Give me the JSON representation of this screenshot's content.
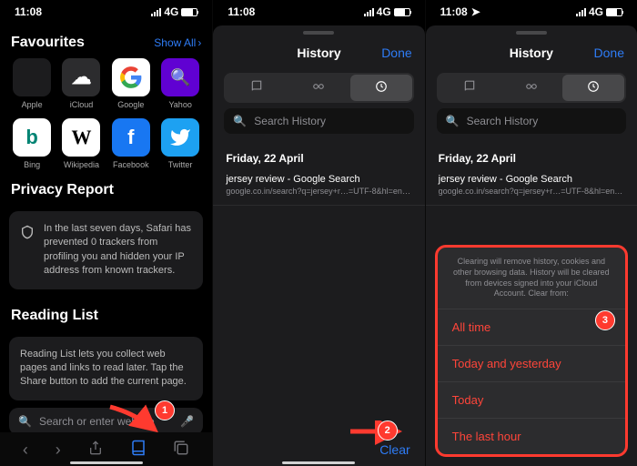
{
  "status": {
    "time": "11:08",
    "network": "4G"
  },
  "screen1": {
    "favourites": {
      "title": "Favourites",
      "showAll": "Show All"
    },
    "favItems": [
      {
        "label": "Apple"
      },
      {
        "label": "iCloud"
      },
      {
        "label": "Google"
      },
      {
        "label": "Yahoo"
      },
      {
        "label": "Bing"
      },
      {
        "label": "Wikipedia"
      },
      {
        "label": "Facebook"
      },
      {
        "label": "Twitter"
      }
    ],
    "privacy": {
      "title": "Privacy Report",
      "text": "In the last seven days, Safari has prevented 0 trackers from profiling you and hidden your IP address from known trackers."
    },
    "readingList": {
      "title": "Reading List",
      "text": "Reading List lets you collect web pages and links to read later. Tap the Share button to add the current page."
    },
    "search": {
      "placeholder": "Search or enter website"
    }
  },
  "history": {
    "title": "History",
    "done": "Done",
    "searchPlaceholder": "Search History",
    "date": "Friday, 22 April",
    "item": {
      "title": "jersey review - Google Search",
      "url": "google.co.in/search?q=jersey+r…=UTF-8&hl=en-in&client=safari"
    },
    "clear": "Clear"
  },
  "clearSheet": {
    "message": "Clearing will remove history, cookies and other browsing data. History will be cleared from devices signed into your iCloud Account. Clear from:",
    "opts": [
      "All time",
      "Today and yesterday",
      "Today",
      "The last hour"
    ]
  },
  "badges": {
    "1": "1",
    "2": "2",
    "3": "3"
  }
}
